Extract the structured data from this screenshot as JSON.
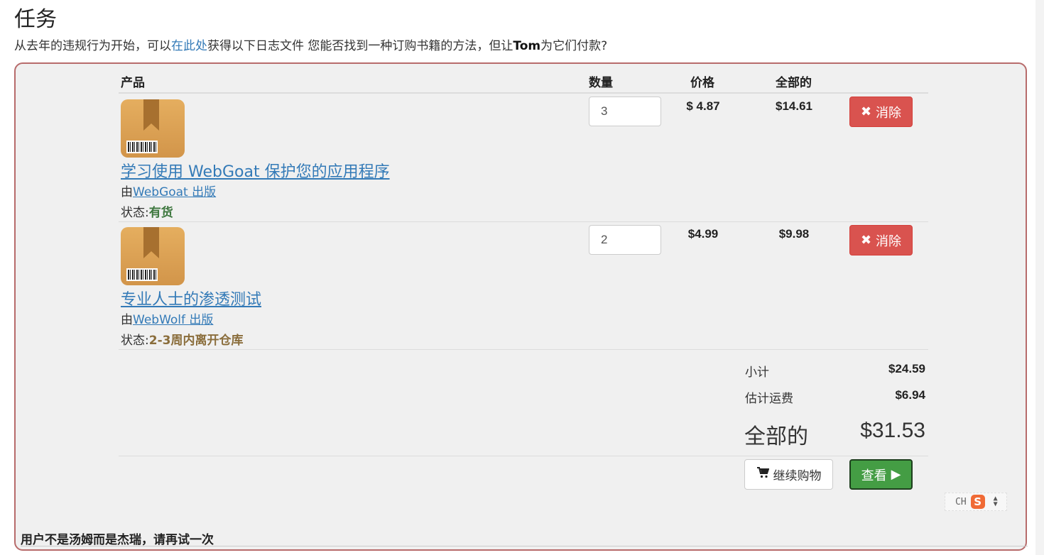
{
  "page": {
    "title": "任务",
    "desc_prefix": "从去年的违规行为开始，可以",
    "desc_link": "在此处",
    "desc_middle": "获得以下日志文件 您能否找到一种订购书籍的方法，但让",
    "desc_bold": "Tom",
    "desc_suffix": "为它们付款?"
  },
  "cart": {
    "headers": {
      "product": "产品",
      "quantity": "数量",
      "price": "价格",
      "total": "全部的"
    },
    "items": [
      {
        "name": "学习使用 WebGoat 保护您的应用程序",
        "by_prefix": "由",
        "publisher": "WebGoat 出版",
        "status_label": "状态:",
        "status": "有货",
        "quantity": "3",
        "price": "$ 4.87",
        "total": "$14.61",
        "remove_label": "消除",
        "image_icon": "package-box-icon"
      },
      {
        "name": "专业人士的渗透测试",
        "by_prefix": "由",
        "publisher": "WebWolf 出版",
        "status_label": "状态:",
        "status": "2-3周内离开仓库",
        "quantity": "2",
        "price": "$4.99",
        "total": "$9.98",
        "remove_label": "消除",
        "image_icon": "package-box-icon"
      }
    ],
    "summary": {
      "subtotal_label": "小计",
      "subtotal": "$24.59",
      "shipping_label": "估计运费",
      "shipping": "$6.94",
      "grand_label": "全部的",
      "grand_total": "$31.53"
    },
    "buttons": {
      "continue_label": "继续购物",
      "checkout_label": "查看"
    }
  },
  "ime": {
    "mode": "CH",
    "logo": "S"
  },
  "feedback": "用户不是汤姆而是杰瑞，请再试一次",
  "colors": {
    "danger": "#d9534f",
    "success": "#449d44",
    "link": "#337ab7",
    "panel_border": "#b76b6b"
  }
}
